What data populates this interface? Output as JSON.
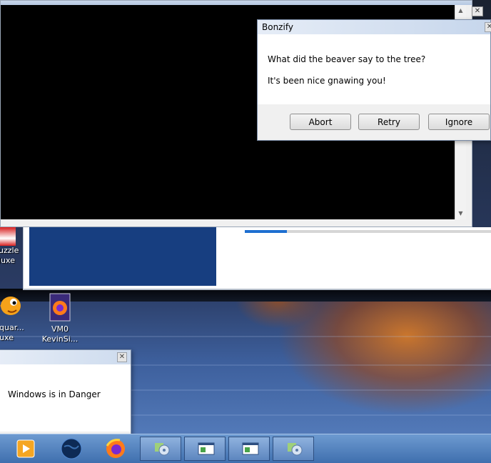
{
  "bonzify_dialog": {
    "title": "Bonzify",
    "close_symbol": "✕",
    "line1": "What did the beaver say to the tree?",
    "line2": "It's been nice gnawing you!",
    "buttons": {
      "abort": "Abort",
      "retry": "Retry",
      "ignore": "Ignore"
    }
  },
  "danger_dialog": {
    "close_symbol": "✕",
    "message": "Windows is in Danger"
  },
  "back_window": {
    "close_symbol": "✕",
    "scroll_up": "▲",
    "scroll_down": "▼"
  },
  "mid_window": {
    "progress_fraction": 0.17
  },
  "desktop_icons": [
    {
      "label": "uzzle\nluxe",
      "icon": "puzzle-game-icon"
    },
    {
      "label": "iquar...\nluxe",
      "icon": "fish-icon"
    },
    {
      "label": "VM0\nKevinSi...",
      "icon": "firefox-file-icon"
    }
  ],
  "taskbar": {
    "icons": [
      "media-player-icon",
      "globe-icon",
      "firefox-icon"
    ],
    "tasks": [
      "setup-disc-icon",
      "window-app-icon",
      "window-app-icon",
      "setup-disc-icon"
    ]
  }
}
